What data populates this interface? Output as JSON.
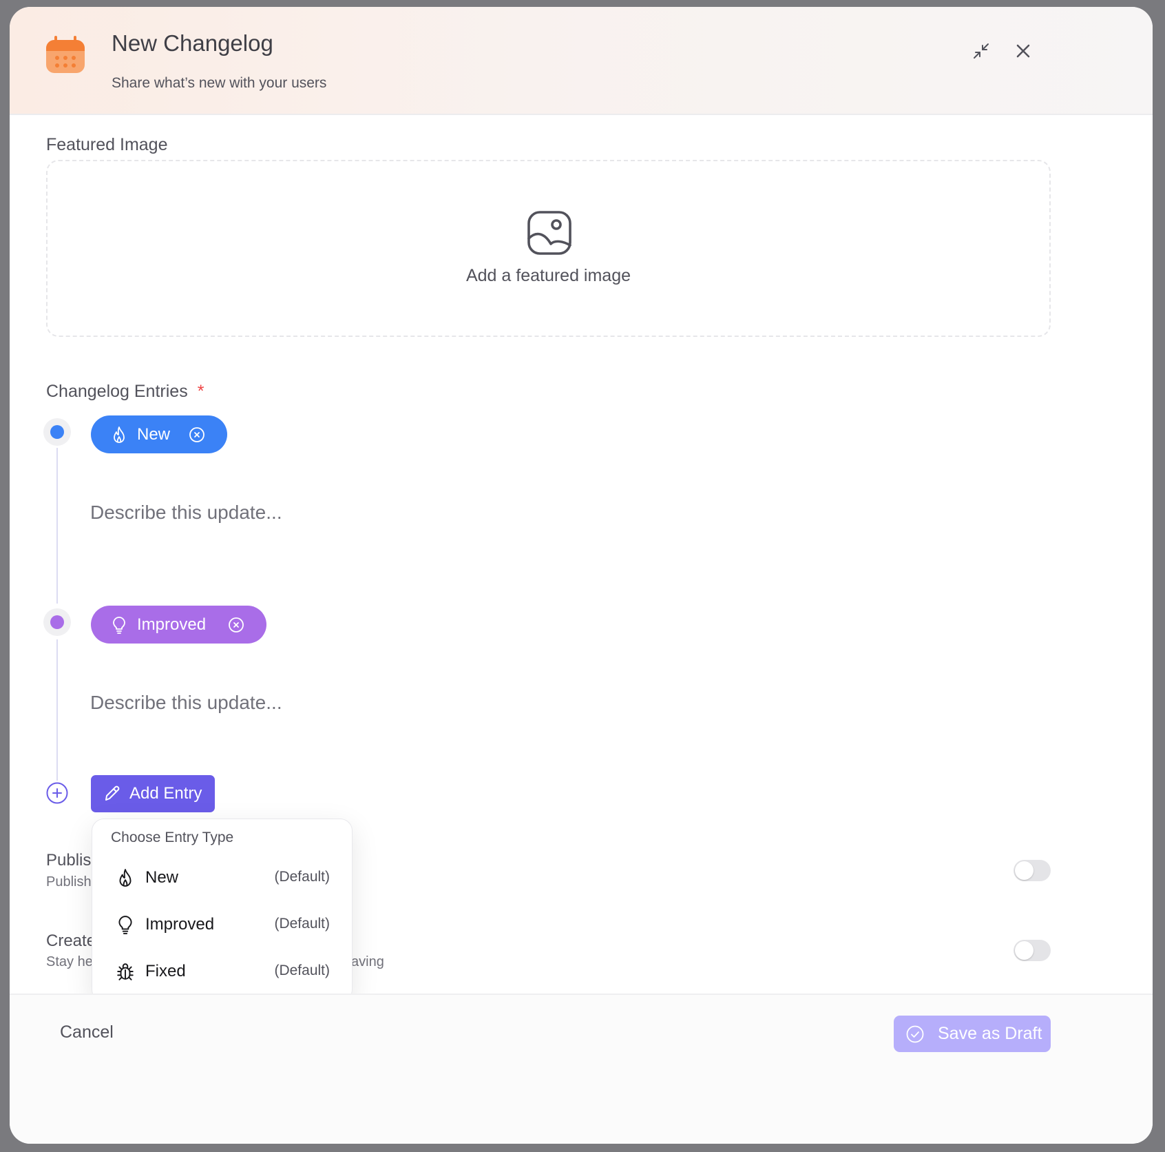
{
  "header": {
    "title": "New Changelog",
    "subtitle": "Share what’s new with your users",
    "app_icon": "calendar-icon",
    "minimize_icon": "minimize-icon",
    "close_icon": "close-icon"
  },
  "featured_image": {
    "label": "Featured Image",
    "cta": "Add a featured image",
    "icon": "image-icon"
  },
  "entries_section": {
    "label": "Changelog Entries",
    "required_mark": "*",
    "entries": [
      {
        "type": "New",
        "icon": "flame-icon",
        "color": "#3b82f6",
        "placeholder": "Describe this update..."
      },
      {
        "type": "Improved",
        "icon": "lightbulb-icon",
        "color": "#a96de8",
        "placeholder": "Describe this update..."
      }
    ],
    "add_button": "Add Entry"
  },
  "dropdown": {
    "title": "Choose Entry Type",
    "items": [
      {
        "label": "New",
        "tag": "(Default)",
        "icon": "flame-icon"
      },
      {
        "label": "Improved",
        "tag": "(Default)",
        "icon": "lightbulb-icon"
      },
      {
        "label": "Fixed",
        "tag": "(Default)",
        "icon": "bug-icon"
      }
    ]
  },
  "settings": {
    "publish_title": "Publis",
    "publish_desc": "Publish",
    "create_title": "Create",
    "create_desc_start": "Stay he",
    "create_desc_end": "aving",
    "publish_toggle_on": false,
    "create_toggle_on": false
  },
  "footer": {
    "cancel": "Cancel",
    "save": "Save as Draft"
  },
  "colors": {
    "accent": "#6a5ce8",
    "new": "#3b82f6",
    "improved": "#a96de8",
    "save_disabled": "#b6aefb",
    "brand_icon": "#f7a36b"
  }
}
